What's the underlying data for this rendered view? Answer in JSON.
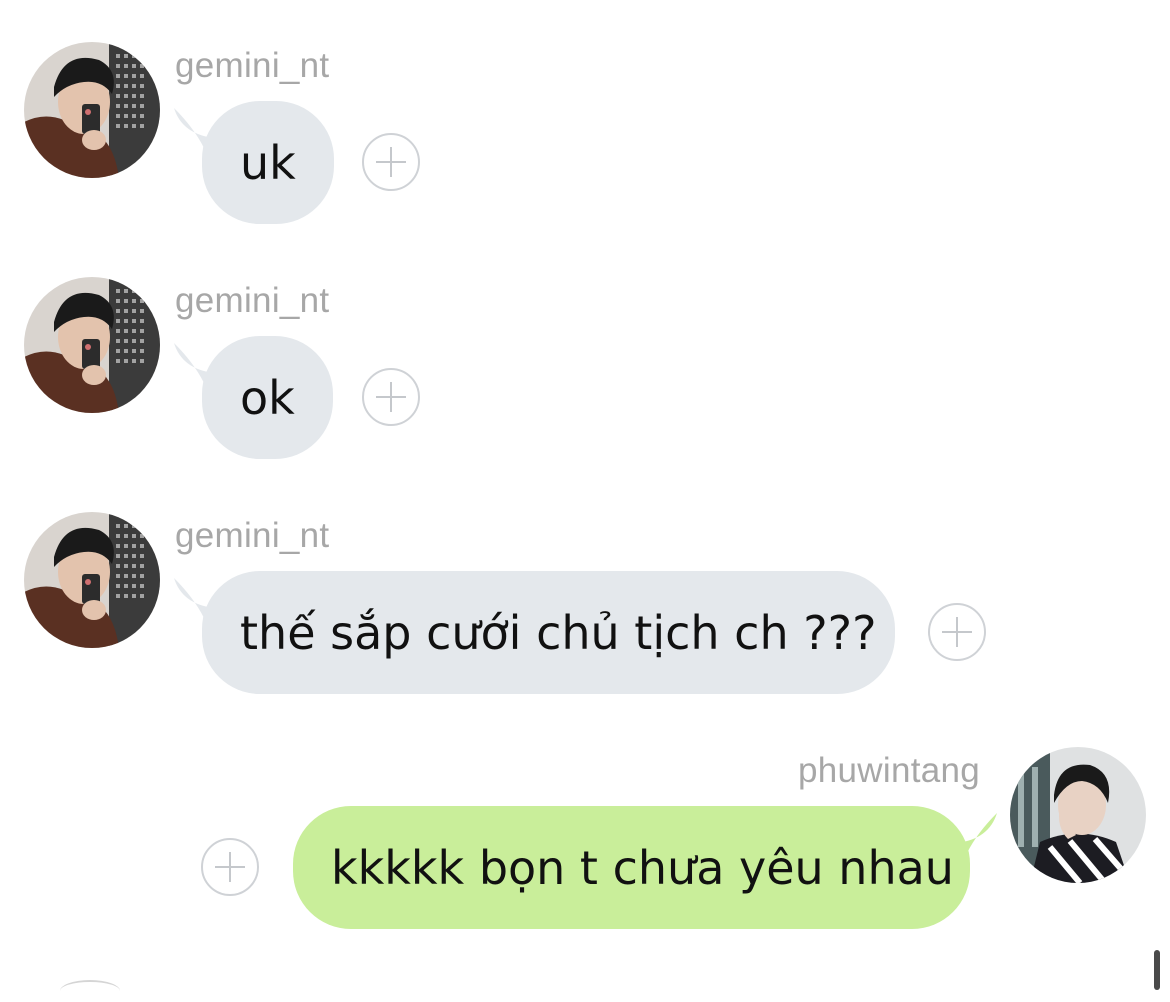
{
  "messages": [
    {
      "sender": "gemini_nt",
      "text": "uk",
      "direction": "incoming",
      "avatar": "gemini-avatar"
    },
    {
      "sender": "gemini_nt",
      "text": "ok",
      "direction": "incoming",
      "avatar": "gemini-avatar"
    },
    {
      "sender": "gemini_nt",
      "text": "thế sắp cưới chủ tịch ch ???",
      "direction": "incoming",
      "avatar": "gemini-avatar"
    },
    {
      "sender": "phuwintang",
      "text": "kkkkk bọn t chưa yêu nhau",
      "direction": "outgoing",
      "avatar": "phuwin-avatar"
    }
  ],
  "icons": {
    "react": "plus-circle-icon"
  },
  "colors": {
    "incoming_bubble": "#e4e8ec",
    "outgoing_bubble": "#c9ee9a",
    "sender_name": "#a7a7a7",
    "background": "#ffffff"
  }
}
